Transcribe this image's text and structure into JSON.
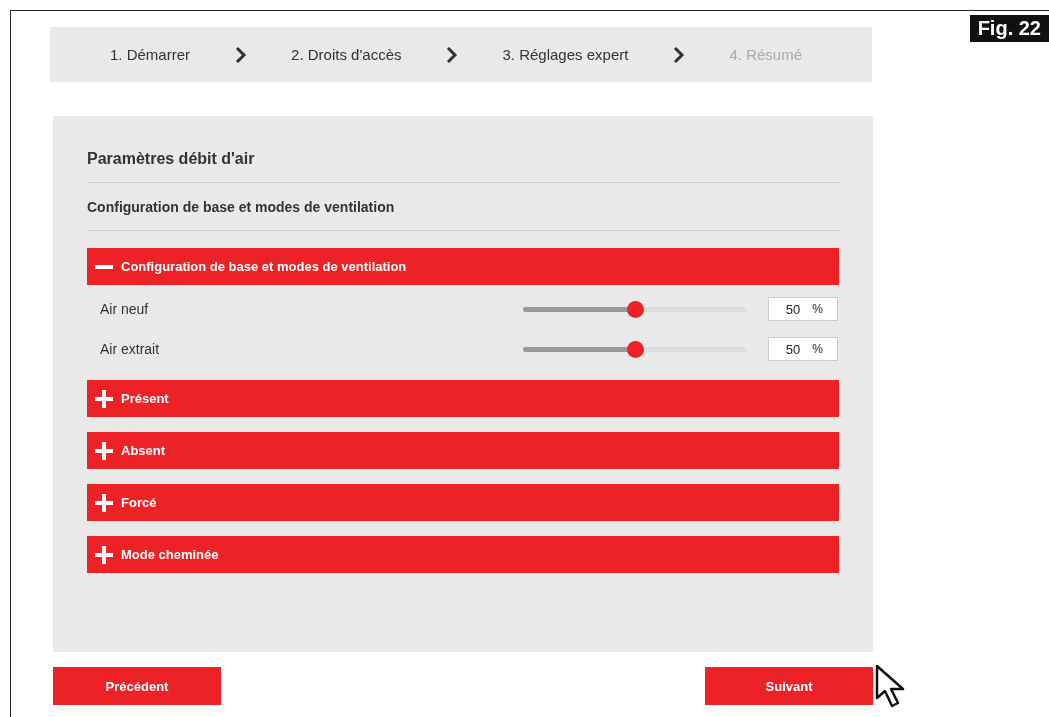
{
  "figure_label": "Fig. 22",
  "steps": [
    {
      "label": "1. Démarrer",
      "disabled": false
    },
    {
      "label": "2. Droits d'accès",
      "disabled": false
    },
    {
      "label": "3. Réglages expert",
      "disabled": false
    },
    {
      "label": "4. Résumé",
      "disabled": true
    }
  ],
  "panel": {
    "title": "Paramètres débit d'air",
    "subtitle": "Configuration de base et modes de ventilation"
  },
  "sections": [
    {
      "title": "Configuration de base et modes de ventilation",
      "expanded": true,
      "rows": [
        {
          "label": "Air neuf",
          "level": 0.5,
          "value": "50",
          "unit": "%"
        },
        {
          "label": "Air extrait",
          "level": 0.5,
          "value": "50",
          "unit": "%"
        }
      ]
    },
    {
      "title": "Présent",
      "expanded": false
    },
    {
      "title": "Absent",
      "expanded": false
    },
    {
      "title": "Forcé",
      "expanded": false
    },
    {
      "title": "Mode cheminée",
      "expanded": false
    }
  ],
  "buttons": {
    "back": "Précédent",
    "next": "Suivant"
  }
}
